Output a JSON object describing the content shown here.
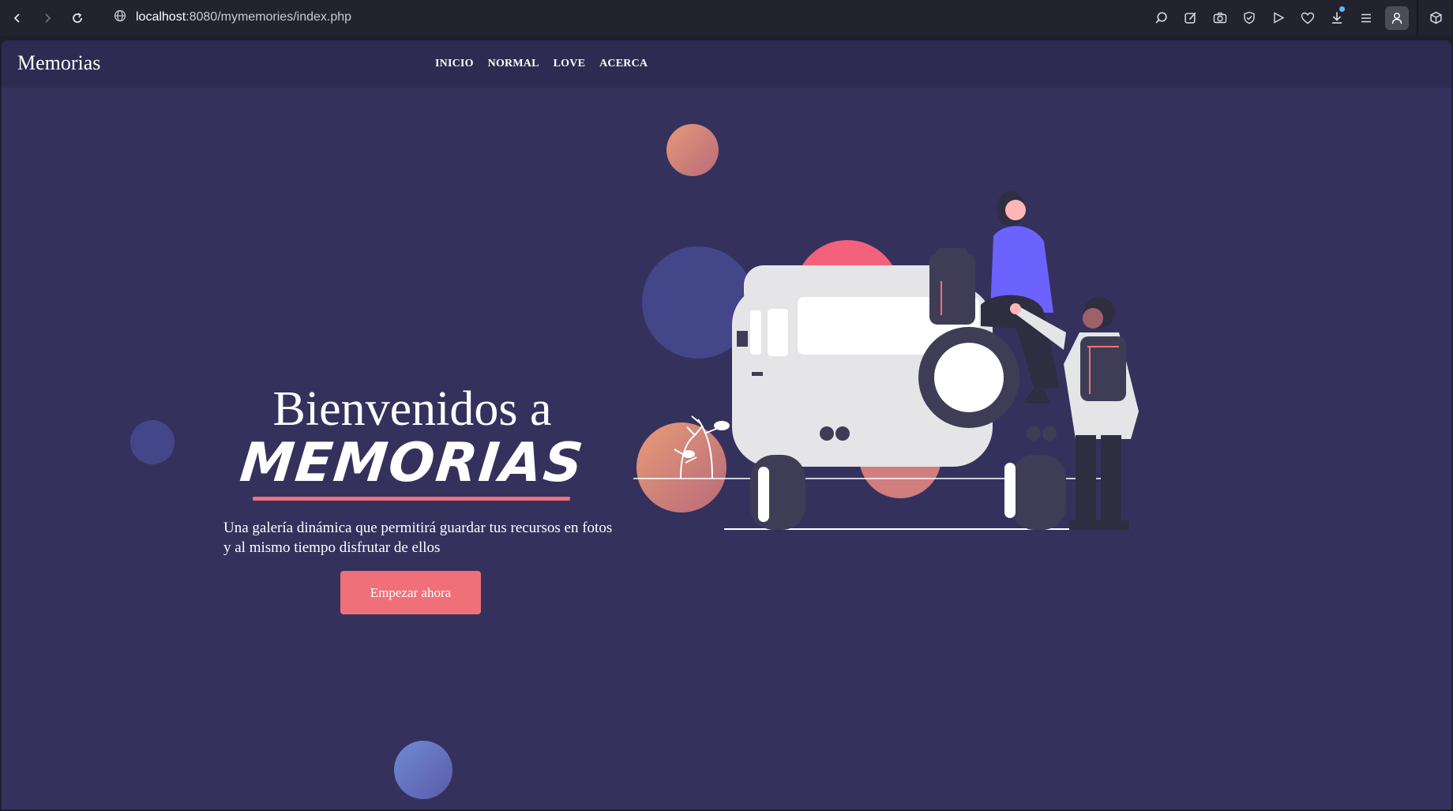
{
  "browser": {
    "url_host": "localhost",
    "url_rest": ":8080/mymemories/index.php",
    "icons": [
      "back-icon",
      "forward-icon",
      "reload-icon",
      "site-info-icon",
      "search-icon",
      "edit-icon",
      "camera-icon",
      "shield-icon",
      "play-icon",
      "heart-icon",
      "download-icon",
      "menu-icon",
      "profile-icon",
      "extensions-icon"
    ]
  },
  "site": {
    "brand": "Memorias",
    "nav": [
      "INICIO",
      "NORMAL",
      "LOVE",
      "ACERCA"
    ]
  },
  "hero": {
    "title": "Bienvenidos a",
    "brand": "MEMORIAS",
    "subtitle": "Una galería dinámica que permitirá guardar tus recursos en fotos y al mismo tiempo disfrutar de ellos",
    "cta": "Empezar ahora"
  },
  "colors": {
    "background": "#34325d",
    "header": "#2e2b52",
    "accent": "#f07079",
    "violet": "#6c63ff",
    "bubble_blue": "#44468a"
  }
}
